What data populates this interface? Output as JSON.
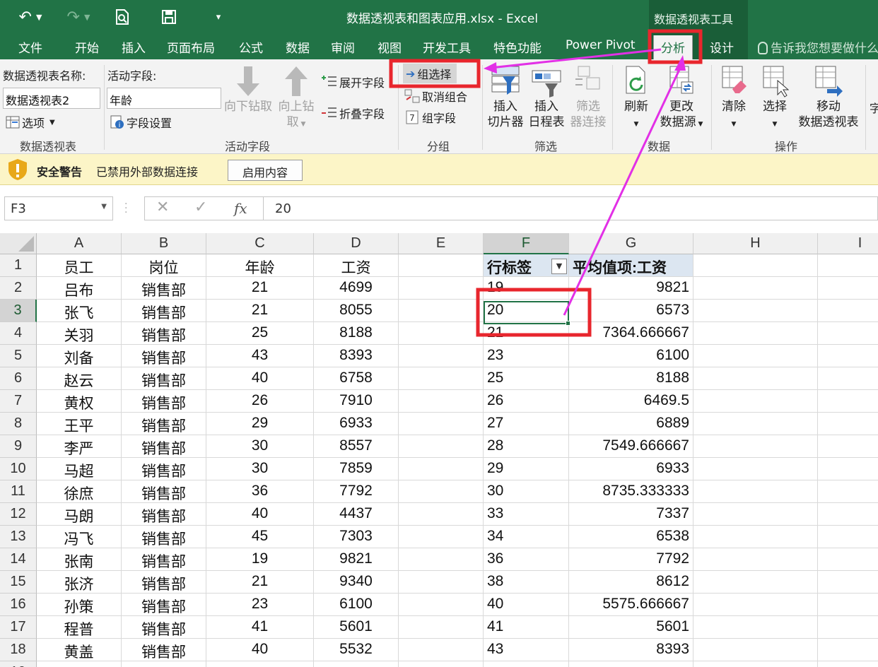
{
  "window": {
    "title": "数据透视表和图表应用.xlsx - Excel",
    "context_title": "数据透视表工具"
  },
  "tabs": [
    "文件",
    "开始",
    "插入",
    "页面布局",
    "公式",
    "数据",
    "审阅",
    "视图",
    "开发工具",
    "特色功能",
    "Power Pivot",
    "分析",
    "设计"
  ],
  "active_tab": "分析",
  "tell_me": "告诉我您想要做什么",
  "ribbon": {
    "pivot": {
      "name_label": "数据透视表名称:",
      "name_value": "数据透视表2",
      "options": "选项",
      "group_label": "数据透视表"
    },
    "active_field": {
      "label": "活动字段:",
      "value": "年龄",
      "settings": "字段设置",
      "drill_down_1": "向下钻取",
      "drill_up_1": "向上钻",
      "drill_up_2": "取",
      "expand": "展开字段",
      "collapse": "折叠字段",
      "group_label": "活动字段"
    },
    "group": {
      "group_selection": "组选择",
      "ungroup": "取消组合",
      "group_field": "组字段",
      "group_label": "分组"
    },
    "filter": {
      "slicer_1": "插入",
      "slicer_2": "切片器",
      "timeline_1": "插入",
      "timeline_2": "日程表",
      "conn_1": "筛选",
      "conn_2": "器连接",
      "group_label": "筛选"
    },
    "data": {
      "refresh": "刷新",
      "change_1": "更改",
      "change_2": "数据源",
      "group_label": "数据"
    },
    "actions": {
      "clear": "清除",
      "select": "选择",
      "move_1": "移动",
      "move_2": "数据透视表",
      "group_label": "操作"
    },
    "overflow": "字"
  },
  "security": {
    "title": "安全警告",
    "message": "已禁用外部数据连接",
    "button": "启用内容"
  },
  "formula_bar": {
    "name_box": "F3",
    "fx": "fx",
    "value": "20"
  },
  "columns": [
    "A",
    "B",
    "C",
    "D",
    "E",
    "F",
    "G",
    "H",
    "I"
  ],
  "source_table": {
    "headers": [
      "员工",
      "岗位",
      "年龄",
      "工资"
    ],
    "rows": [
      [
        "吕布",
        "销售部",
        "21",
        "4699"
      ],
      [
        "张飞",
        "销售部",
        "21",
        "8055"
      ],
      [
        "关羽",
        "销售部",
        "25",
        "8188"
      ],
      [
        "刘备",
        "销售部",
        "43",
        "8393"
      ],
      [
        "赵云",
        "销售部",
        "40",
        "6758"
      ],
      [
        "黄权",
        "销售部",
        "26",
        "7910"
      ],
      [
        "王平",
        "销售部",
        "29",
        "6933"
      ],
      [
        "李严",
        "销售部",
        "30",
        "8557"
      ],
      [
        "马超",
        "销售部",
        "30",
        "7859"
      ],
      [
        "徐庶",
        "销售部",
        "36",
        "7792"
      ],
      [
        "马朗",
        "销售部",
        "40",
        "4437"
      ],
      [
        "冯飞",
        "销售部",
        "45",
        "7303"
      ],
      [
        "张南",
        "销售部",
        "19",
        "9821"
      ],
      [
        "张济",
        "销售部",
        "21",
        "9340"
      ],
      [
        "孙策",
        "销售部",
        "23",
        "6100"
      ],
      [
        "程普",
        "销售部",
        "41",
        "5601"
      ],
      [
        "黄盖",
        "销售部",
        "40",
        "5532"
      ]
    ]
  },
  "pivot_table": {
    "row_label": "行标签",
    "value_label": "平均值项:工资",
    "rows": [
      [
        "19",
        "9821"
      ],
      [
        "20",
        "6573"
      ],
      [
        "21",
        "7364.666667"
      ],
      [
        "23",
        "6100"
      ],
      [
        "25",
        "8188"
      ],
      [
        "26",
        "6469.5"
      ],
      [
        "27",
        "6889"
      ],
      [
        "28",
        "7549.666667"
      ],
      [
        "29",
        "6933"
      ],
      [
        "30",
        "8735.333333"
      ],
      [
        "33",
        "7337"
      ],
      [
        "34",
        "6538"
      ],
      [
        "36",
        "7792"
      ],
      [
        "38",
        "8612"
      ],
      [
        "40",
        "5575.666667"
      ],
      [
        "41",
        "5601"
      ],
      [
        "43",
        "8393"
      ]
    ]
  },
  "colors": {
    "excel_green": "#217346",
    "annotation_red": "#e8262d",
    "annotation_magenta": "#e230e6",
    "pivot_header": "#dce6f1"
  }
}
